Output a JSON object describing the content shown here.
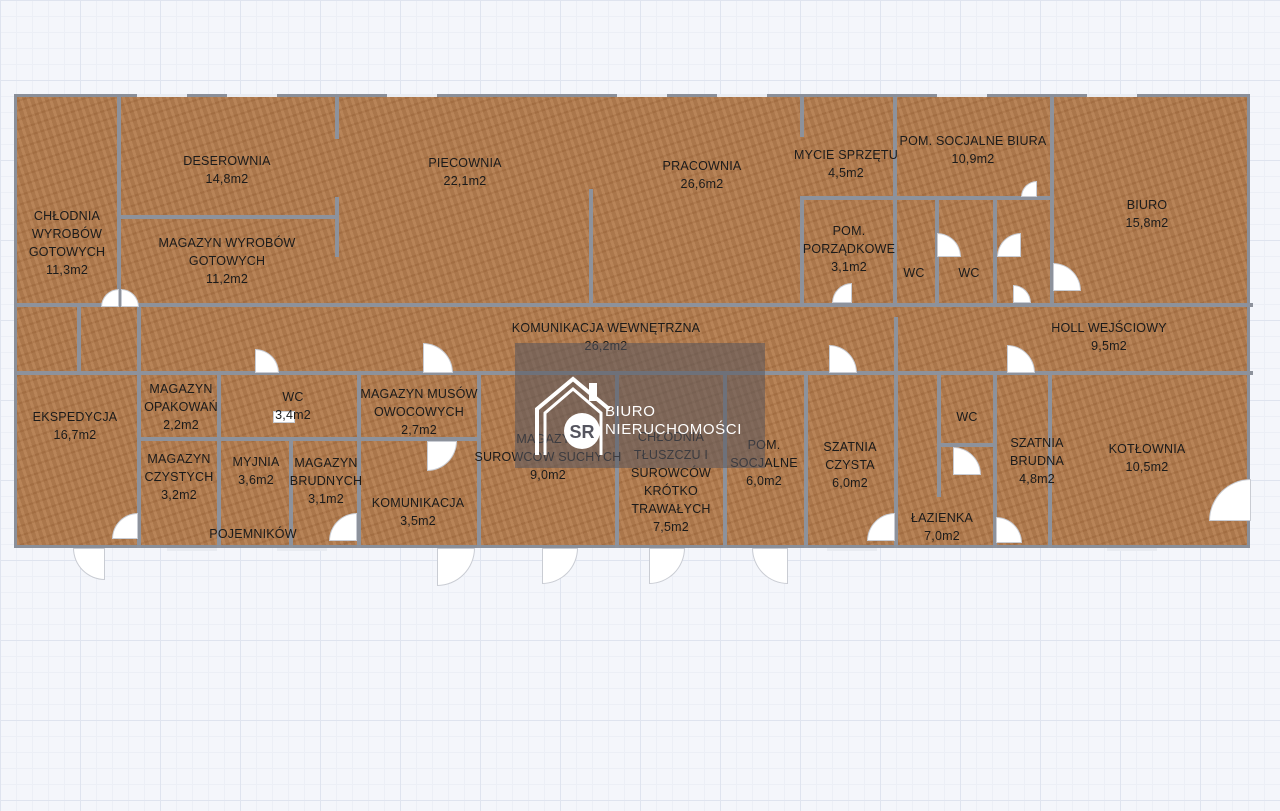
{
  "watermark": {
    "line1": "BIURO",
    "line2": "NIERUCHOMOŚCI",
    "monogram": "SR"
  },
  "rooms": {
    "chlodnia": {
      "lines": [
        "CHŁODNIA",
        "WYROBÓW",
        "GOTOWYCH",
        "11,3m2"
      ]
    },
    "deserownia": {
      "lines": [
        "DESEROWNIA",
        "14,8m2"
      ]
    },
    "piecownia": {
      "lines": [
        "PIECOWNIA",
        "22,1m2"
      ]
    },
    "pracownia": {
      "lines": [
        "PRACOWNIA",
        "26,6m2"
      ]
    },
    "mycie": {
      "lines": [
        "MYCIE SPRZĘTU",
        "4,5m2"
      ]
    },
    "socjalne_biura": {
      "lines": [
        "POM. SOCJALNE BIURA",
        "10,9m2"
      ]
    },
    "biuro": {
      "lines": [
        "BIURO",
        "15,8m2"
      ]
    },
    "magazyn_wyrobow": {
      "lines": [
        "MAGAZYN WYROBÓW",
        "GOTOWYCH",
        "11,2m2"
      ]
    },
    "porzadkowe": {
      "lines": [
        "POM.",
        "PORZĄDKOWE",
        "3,1m2"
      ]
    },
    "wc1": {
      "lines": [
        "WC"
      ]
    },
    "wc2": {
      "lines": [
        "WC"
      ]
    },
    "komunikacja_wew": {
      "lines": [
        "KOMUNIKACJA WEWNĘTRZNA",
        "26,2m2"
      ]
    },
    "holl": {
      "lines": [
        "HOLL WEJŚCIOWY",
        "9,5m2"
      ]
    },
    "ekspedycja": {
      "lines": [
        "EKSPEDYCJA",
        "16,7m2"
      ]
    },
    "opakowan": {
      "lines": [
        "MAGAZYN",
        "OPAKOWAŃ",
        "2,2m2"
      ]
    },
    "wc3": {
      "lines": [
        "WC",
        "3,4m2"
      ]
    },
    "musow": {
      "lines": [
        "MAGAZYN MUSÓW",
        "OWOCOWYCH",
        "2,7m2"
      ]
    },
    "surowcow_suchych": {
      "lines": [
        "MAGAZYN",
        "SUROWCÓW SUCHYCH",
        "9,0m2"
      ]
    },
    "chlodnia_tluszczu": {
      "lines": [
        "CHŁODNIA",
        "TŁUSZCZU I",
        "SUROWCÓW",
        "KRÓTKO",
        "TRAWAŁYCH",
        "7,5m2"
      ]
    },
    "socjalne": {
      "lines": [
        "POM.",
        "SOCJALNE",
        "6,0m2"
      ]
    },
    "szatnia_czysta": {
      "lines": [
        "SZATNIA",
        "CZYSTA",
        "6,0m2"
      ]
    },
    "wc4": {
      "lines": [
        "WC"
      ]
    },
    "szatnia_brudna": {
      "lines": [
        "SZATNIA",
        "BRUDNA",
        "4,8m2"
      ]
    },
    "kotlownia": {
      "lines": [
        "KOTŁOWNIA",
        "10,5m2"
      ]
    },
    "czystych": {
      "lines": [
        "MAGAZYN",
        "CZYSTYCH",
        "3,2m2"
      ]
    },
    "myjnia": {
      "lines": [
        "MYJNIA",
        "3,6m2"
      ]
    },
    "brudnych": {
      "lines": [
        "MAGAZYN",
        "BRUDNYCH",
        "3,1m2"
      ]
    },
    "komunikacja": {
      "lines": [
        "KOMUNIKACJA",
        "3,5m2"
      ]
    },
    "pojemnikow": {
      "lines": [
        "POJEMNIKÓW"
      ]
    },
    "lazienka": {
      "lines": [
        "ŁAZIENKA",
        "7,0m2"
      ]
    }
  },
  "colors": {
    "floor": "#b0784a",
    "wall": "#8d929c",
    "grid": "#dfe4ef"
  }
}
